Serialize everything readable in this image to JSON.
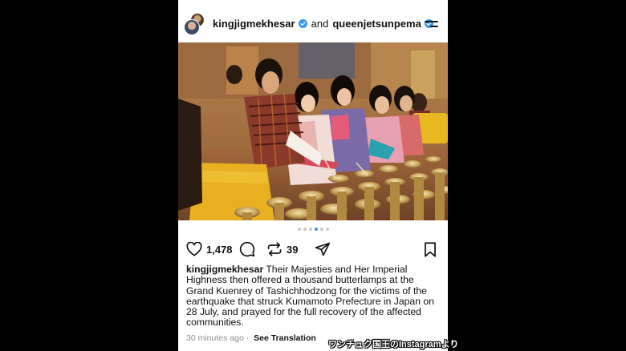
{
  "header": {
    "user1": "kingjigmekhesar",
    "joiner": "and",
    "user2": "queenjetsunpema"
  },
  "carousel": {
    "dot_count": 6,
    "active_index": 3
  },
  "actions": {
    "likes": "1,478",
    "reposts": "39"
  },
  "caption": {
    "username": "kingjigmekhesar",
    "text": "Their Majesties and Her Imperial Highness then offered a thousand butterlamps at the Grand Kuenrey of Tashichhodzong for the victims of the earthquake that struck Kumamoto Prefecture in Japan on 28 July, and prayed for the full recovery of the affected communities."
  },
  "meta": {
    "time": "30 minutes ago",
    "separator": "·",
    "translate": "See Translation"
  },
  "credit": "ワンチュク国王のInstagramより",
  "colors": {
    "verified": "#3897f0",
    "active_dot": "#3897f0"
  }
}
